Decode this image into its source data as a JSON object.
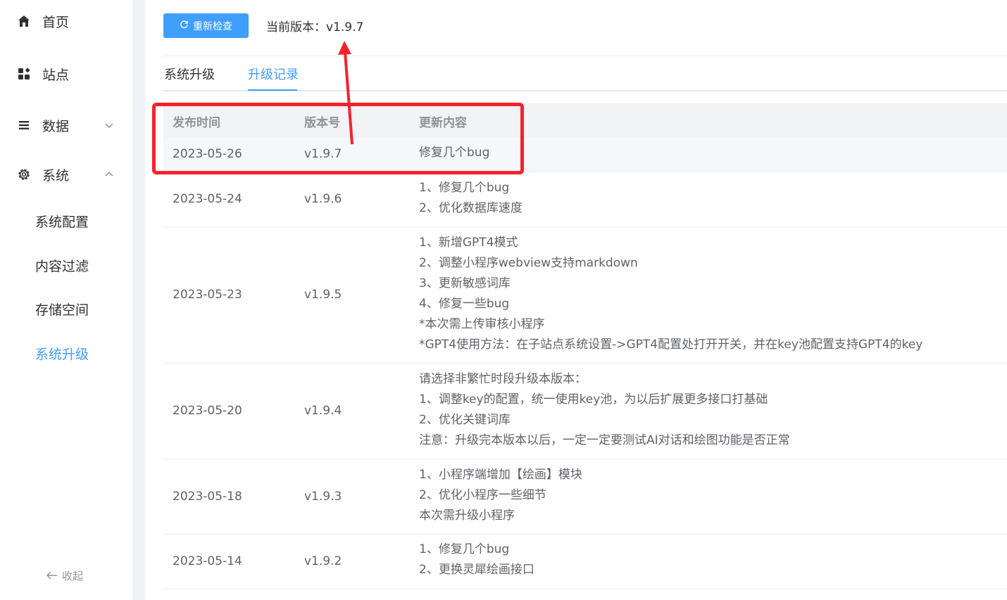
{
  "sidebar": {
    "items": [
      {
        "label": "首页",
        "icon": "home-icon"
      },
      {
        "label": "站点",
        "icon": "grid-icon"
      },
      {
        "label": "数据",
        "icon": "list-icon"
      },
      {
        "label": "系统",
        "icon": "gear-icon"
      }
    ],
    "sub_items": [
      {
        "label": "系统配置"
      },
      {
        "label": "内容过滤"
      },
      {
        "label": "存储空间"
      },
      {
        "label": "系统升级"
      }
    ],
    "collapse_label": "收起"
  },
  "top": {
    "recheck_label": "重新检查",
    "current_version": "当前版本：v1.9.7"
  },
  "tabs": [
    {
      "label": "系统升级"
    },
    {
      "label": "升级记录"
    }
  ],
  "table": {
    "headers": [
      "发布时间",
      "版本号",
      "更新内容"
    ],
    "rows": [
      {
        "date": "2023-05-26",
        "version": "v1.9.7",
        "content": [
          "修复几个bug"
        ]
      },
      {
        "date": "2023-05-24",
        "version": "v1.9.6",
        "content": [
          "1、修复几个bug",
          "2、优化数据库速度"
        ]
      },
      {
        "date": "2023-05-23",
        "version": "v1.9.5",
        "content": [
          "1、新增GPT4模式",
          "2、调整小程序webview支持markdown",
          "3、更新敏感词库",
          "4、修复一些bug",
          "*本次需上传审核小程序",
          "*GPT4使用方法：在子站点系统设置->GPT4配置处打开开关，并在key池配置支持GPT4的key"
        ]
      },
      {
        "date": "2023-05-20",
        "version": "v1.9.4",
        "content": [
          "请选择非繁忙时段升级本版本：",
          "1、调整key的配置，统一使用key池，为以后扩展更多接口打基础",
          "2、优化关键词库",
          "注意：升级完本版本以后，一定一定要测试AI对话和绘图功能是否正常"
        ]
      },
      {
        "date": "2023-05-18",
        "version": "v1.9.3",
        "content": [
          "1、小程序端增加【绘画】模块",
          "2、优化小程序一些细节",
          "本次需升级小程序"
        ]
      },
      {
        "date": "2023-05-14",
        "version": "v1.9.2",
        "content": [
          "1、修复几个bug",
          "2、更换灵犀绘画接口"
        ]
      }
    ]
  },
  "colors": {
    "accent": "#409eff",
    "annotation": "#f5222d"
  }
}
